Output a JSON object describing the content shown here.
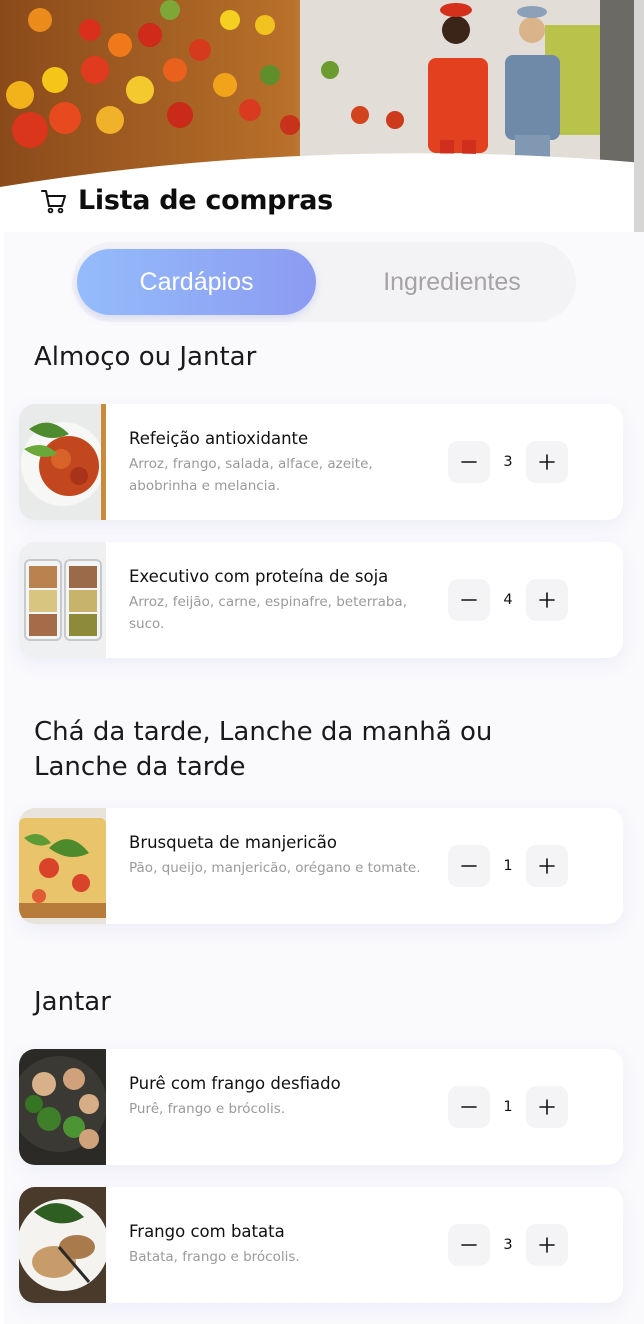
{
  "header": {
    "title": "Lista de compras",
    "cart_icon": "shopping-cart-icon"
  },
  "tabs": [
    {
      "label": "Cardápios",
      "active": true
    },
    {
      "label": "Ingredientes",
      "active": false
    }
  ],
  "sections": [
    {
      "title": "Almoço ou Jantar",
      "items": [
        {
          "name": "Refeição antioxidante",
          "desc": "Arroz, frango, salada, alface, azeite, abobrinha e melancia.",
          "qty": "3"
        },
        {
          "name": "Executivo com proteína de soja",
          "desc": "Arroz, feijão, carne, espinafre, beterraba, suco.",
          "qty": "4"
        }
      ]
    },
    {
      "title": "Chá da tarde, Lanche da manhã ou Lanche da tarde",
      "items": [
        {
          "name": "Brusqueta de manjericão",
          "desc": "Pão, queijo, manjericão, orégano e tomate.",
          "qty": "1"
        }
      ]
    },
    {
      "title": "Jantar",
      "items": [
        {
          "name": "Purê com frango desfiado",
          "desc": "Purê, frango e brócolis.",
          "qty": "1"
        },
        {
          "name": "Frango com batata",
          "desc": "Batata, frango e brócolis.",
          "qty": "3"
        }
      ]
    }
  ],
  "colors": {
    "accent_start": "#94bcfb",
    "accent_end": "#8c9bf1",
    "muted_text": "#9a9a9a"
  }
}
